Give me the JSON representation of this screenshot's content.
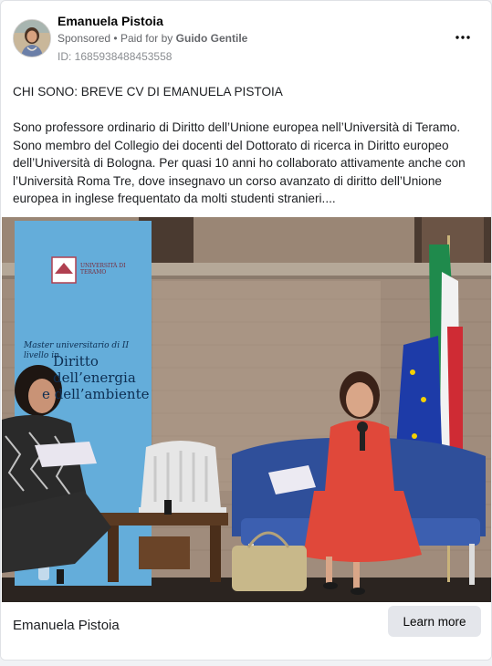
{
  "post": {
    "page_name": "Emanuela Pistoia",
    "sponsored": "Sponsored",
    "separator": "•",
    "paid_for_prefix": "Paid for by",
    "paid_for_by": "Guido Gentile",
    "ad_id": "ID: 1685938488453558",
    "more_icon": "more-horizontal-icon",
    "heading": "CHI SONO: BREVE CV DI EMANUELA PISTOIA",
    "body": "Sono professore ordinario di Diritto dell’Unione europea nell’Università di Teramo. Sono membro del Collegio dei docenti del Dottorato di ricerca in Diritto europeo dell’Università di Bologna. Per quasi 10 anni ho collaborato attivamente anche con l’Università Roma Tre, dove insegnavo un corso avanzato di diritto dell’Unione europea in inglese frequentato da molti studenti stranieri...."
  },
  "photo": {
    "banner": {
      "logo_text": "UNIVERSITÀ DI TERAMO",
      "subtitle": "Master universitario di II livello in",
      "title_line1": "Diritto",
      "title_line2": "dell’energia",
      "title_line3": "e dell’ambiente"
    }
  },
  "footer": {
    "name": "Emanuela Pistoia",
    "cta_label": "Learn more"
  },
  "colors": {
    "card_bg": "#ffffff",
    "page_bg": "#f0f2f5",
    "cta_bg": "#e4e6eb",
    "secondary_text": "#65676b",
    "banner_blue": "#5aa6d6",
    "dress_red": "#e0483a"
  }
}
